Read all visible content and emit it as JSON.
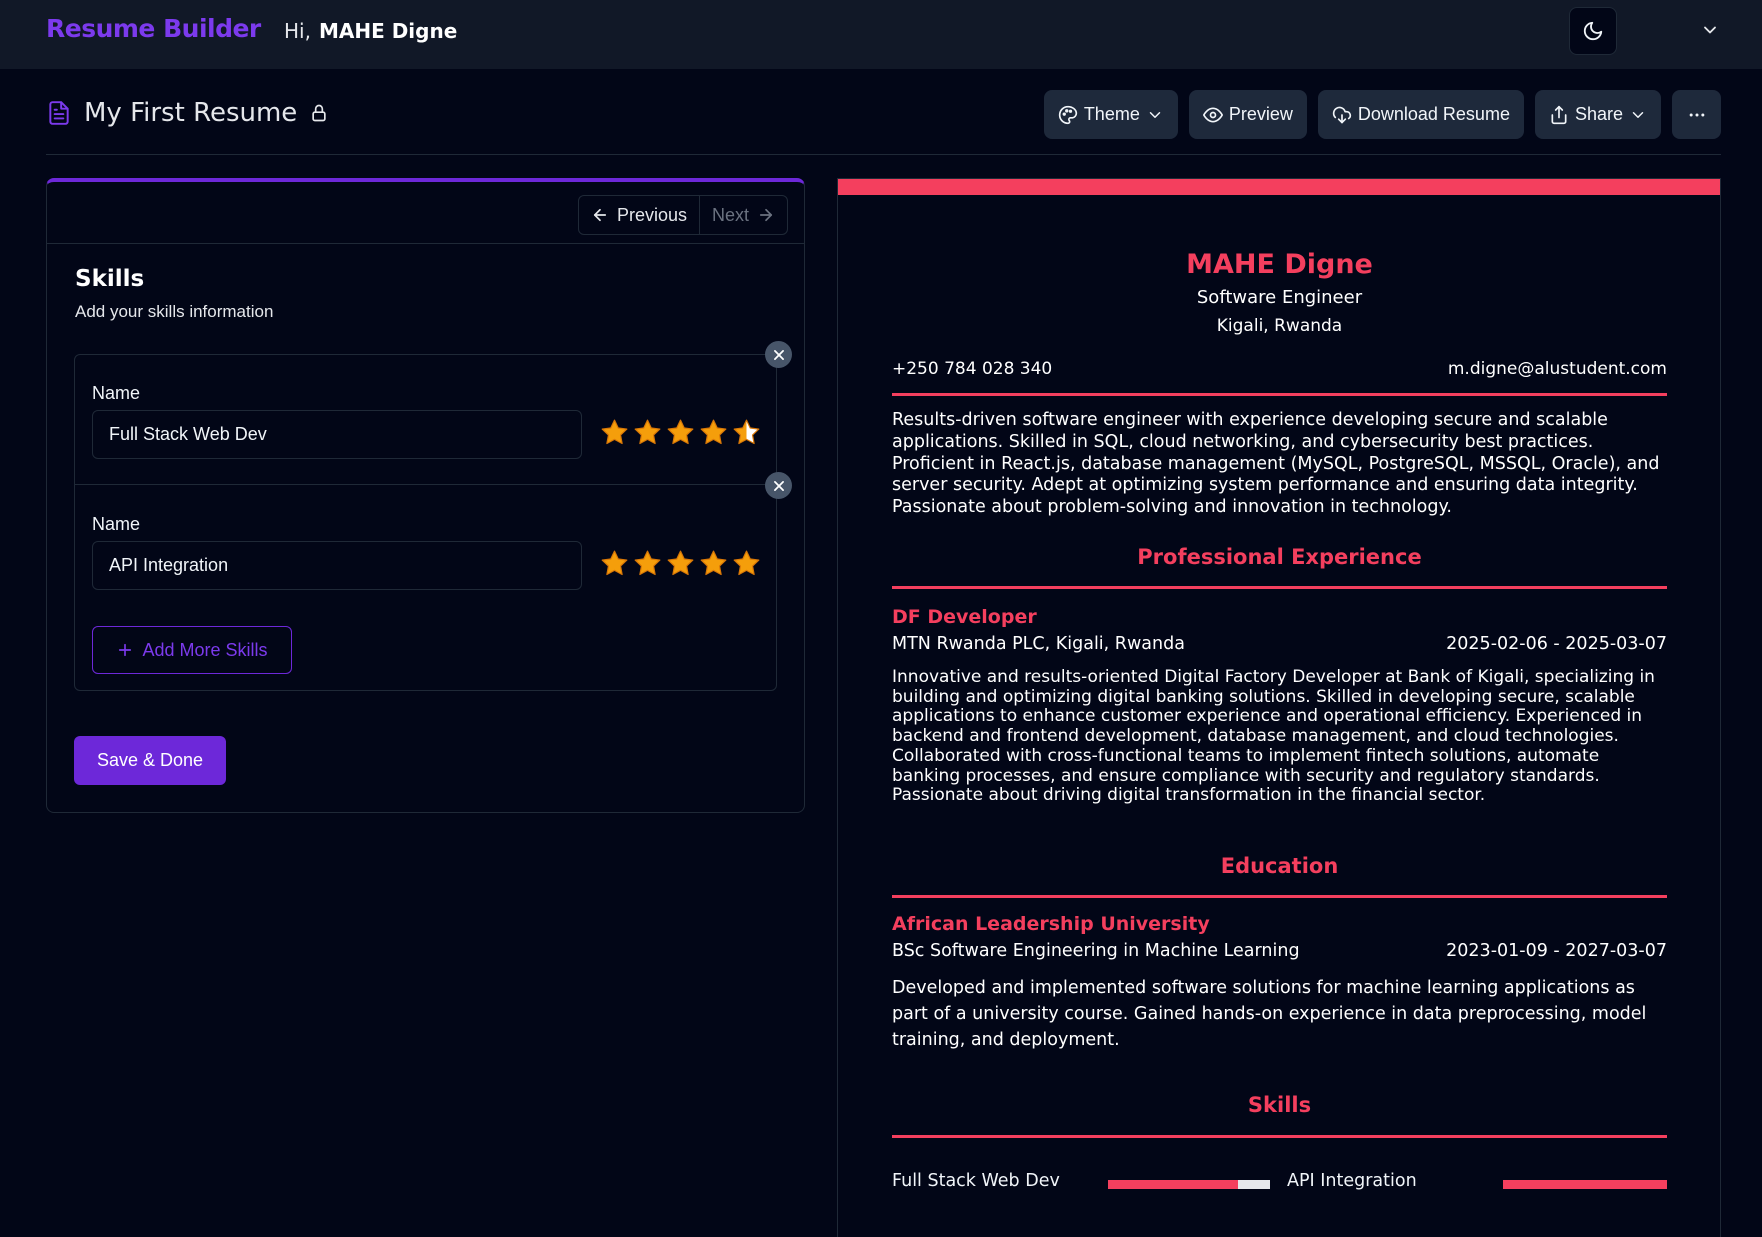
{
  "nav": {
    "brand": "Resume Builder",
    "greeting": "Hi,",
    "user_name": "MAHE Digne",
    "theme_icon": "moon-icon",
    "menu_icon": "chevron-down-icon"
  },
  "doc": {
    "title": "My First Resume",
    "toolbar": {
      "theme_label": "Theme",
      "preview_label": "Preview",
      "download_label": "Download Resume",
      "share_label": "Share"
    }
  },
  "editor": {
    "prev_label": "Previous",
    "next_label": "Next",
    "section_title": "Skills",
    "section_subtitle": "Add your skills information",
    "skills": [
      {
        "label": "Name",
        "value": "Full Stack Web Dev",
        "rating": 4.5
      },
      {
        "label": "Name",
        "value": "API Integration",
        "rating": 5
      }
    ],
    "add_label": "Add More Skills",
    "save_label": "Save & Done"
  },
  "preview": {
    "name": "MAHE Digne",
    "role": "Software Engineer",
    "location": "Kigali, Rwanda",
    "phone": "+250 784 028 340",
    "email": "m.digne@alustudent.com",
    "summary": "Results-driven software engineer with experience developing secure and scalable applications. Skilled in SQL, cloud networking, and cybersecurity best practices. Proficient in React.js, database management (MySQL, PostgreSQL, MSSQL, Oracle), and server security. Adept at optimizing system performance and ensuring data integrity. Passionate about problem-solving and innovation in technology.",
    "experience_heading": "Professional Experience",
    "experience": {
      "title": "DF Developer",
      "company": "MTN Rwanda PLC, Kigali, Rwanda",
      "dates": "2025-02-06 - 2025-03-07",
      "description": "Innovative and results-oriented Digital Factory Developer at Bank of Kigali, specializing in building and optimizing digital banking solutions. Skilled in developing secure, scalable applications to enhance customer experience and operational efficiency. Experienced in backend and frontend development, database management, and cloud technologies. Collaborated with cross-functional teams to implement fintech solutions, automate banking processes, and ensure compliance with security and regulatory standards. Passionate about driving digital transformation in the financial sector."
    },
    "education_heading": "Education",
    "education": {
      "school": "African Leadership University",
      "degree": "BSc Software Engineering in Machine Learning",
      "dates": "2023-01-09 - 2027-03-07",
      "description": "Developed and implemented software solutions for machine learning applications as part of a university course. Gained hands-on experience in data preprocessing, model training, and deployment."
    },
    "skills_heading": "Skills",
    "skills": [
      {
        "name": "Full Stack Web Dev",
        "level": 0.8
      },
      {
        "name": "API Integration",
        "level": 1.0
      }
    ]
  },
  "colors": {
    "accent": "#6d28d9",
    "resume_accent": "#f43f5e",
    "star": "#f59e0b"
  }
}
